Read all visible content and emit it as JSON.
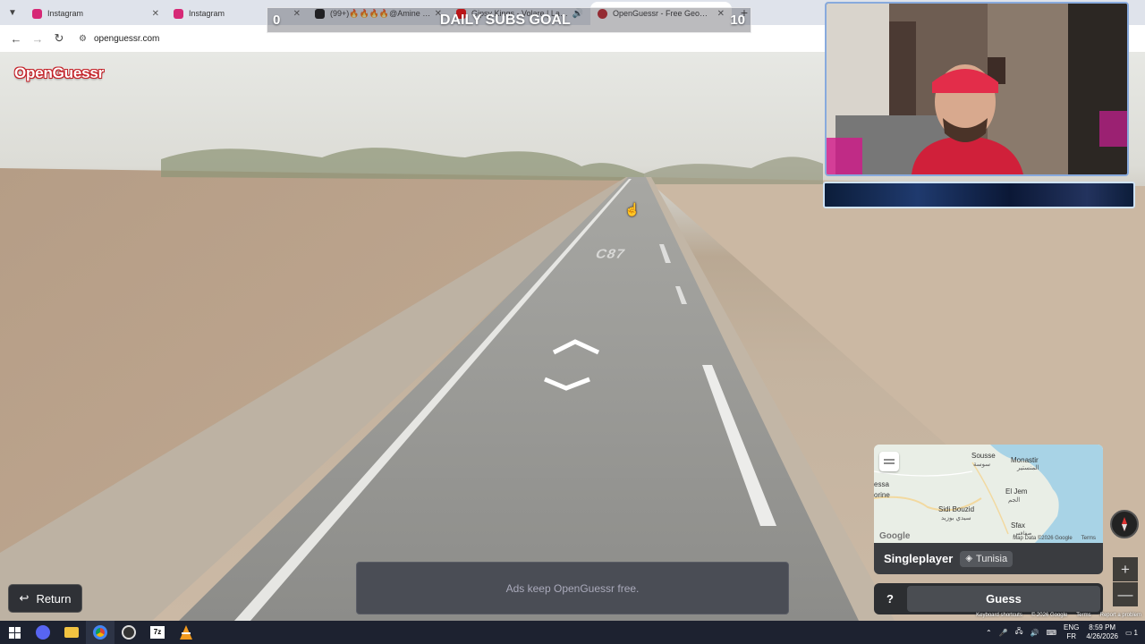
{
  "browser": {
    "tabs": [
      {
        "title": "Instagram",
        "favicon_color": "#d62976",
        "active": false
      },
      {
        "title": "Instagram",
        "favicon_color": "#d62976",
        "active": false
      },
      {
        "title": "(99+)🔥🔥🔥🔥@Amine Limem#...",
        "favicon_color": "#111111",
        "active": false
      },
      {
        "title": "Gipsy Kings - Volare | Latin...",
        "favicon_color": "#ff0000",
        "active": false
      },
      {
        "title": "OpenGuessr - Free GeoGuessr ...",
        "favicon_color": "#c4232a",
        "active": true
      }
    ],
    "address": "openguessr.com",
    "new_tab": "+"
  },
  "overlay": {
    "subs_current": "0",
    "subs_label": "DAILY SUBS GOAL",
    "subs_target": "10"
  },
  "app": {
    "logo": "OpenGuessr",
    "road_marking": "C87"
  },
  "minimap": {
    "labels": {
      "sousse": "Sousse",
      "sousse_ar": "سوسة",
      "monastir": "Monastir",
      "monastir_ar": "المنستير",
      "el_jem": "El Jem",
      "el_jem_ar": "الجم",
      "kairouan_partial": "essa",
      "kairouan_partial2": "orine",
      "sidi_bouzid": "Sidi Bouzid",
      "sidi_bouzid_ar": "سيدي بوزيد",
      "sfax": "Sfax",
      "sfax_ar": "صفاقس"
    },
    "google": "Google",
    "map_data": "Map Data ©2026 Google",
    "terms": "Terms",
    "mode": "Singleplayer",
    "country": "Tunisia"
  },
  "controls": {
    "zoom_in": "+",
    "zoom_out": "—",
    "help": "?",
    "guess": "Guess",
    "return": "Return",
    "ad_text": "Ads keep OpenGuessr free."
  },
  "attribution": {
    "shortcuts": "Keyboard shortcuts",
    "data": "© 2026 Google",
    "terms": "Terms",
    "report": "Report a problem"
  },
  "taskbar": {
    "lang_top": "ENG",
    "lang_bottom": "FR",
    "time": "8:59 PM",
    "date": "4/26/2026",
    "notifications": "1"
  }
}
